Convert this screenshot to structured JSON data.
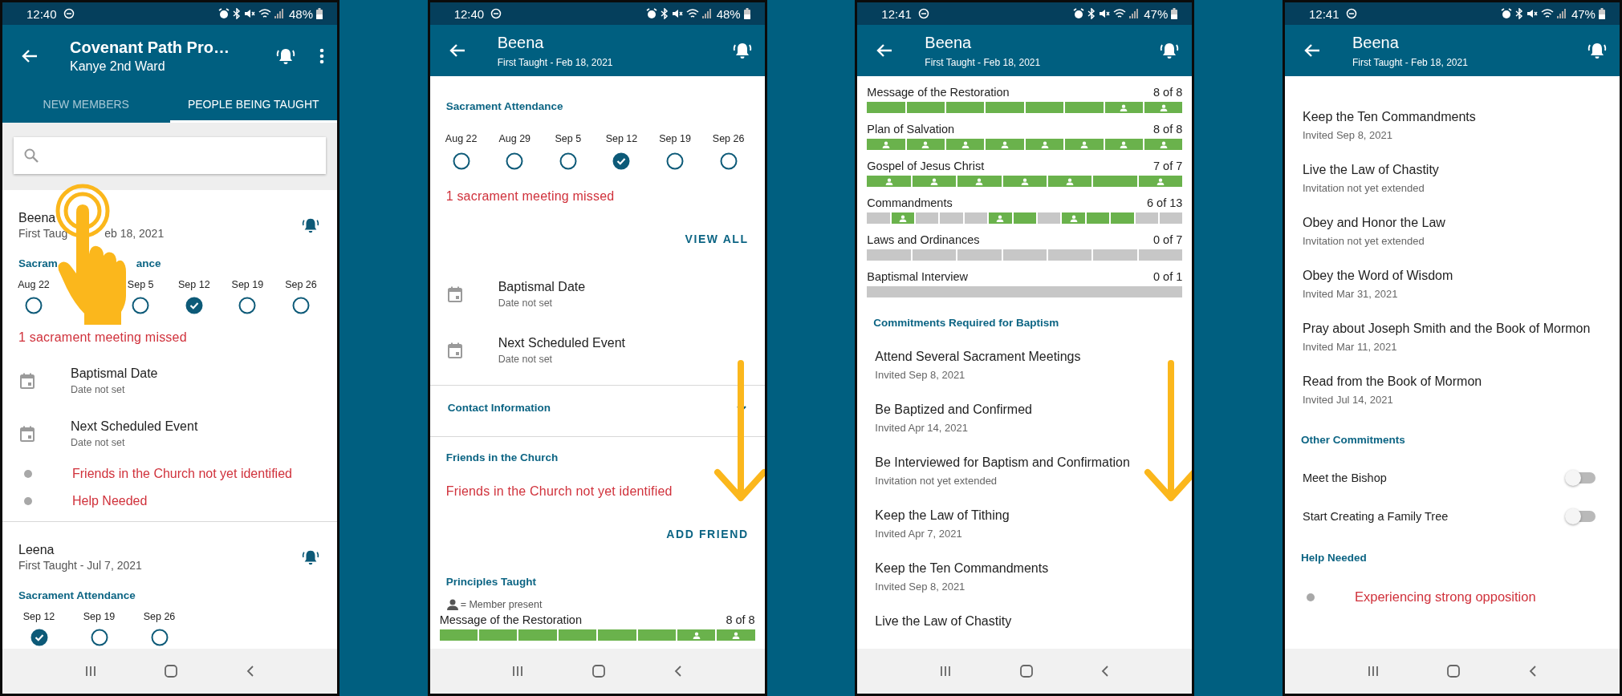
{
  "phones": [
    {
      "status": {
        "time": "12:40",
        "battery": "48%"
      },
      "header": {
        "title": "Covenant Path Pro…",
        "subtitle": "Kanye 2nd Ward",
        "actions": [
          {
            "kind": "bell"
          },
          {
            "kind": "menu"
          }
        ]
      },
      "tabs": [
        {
          "label": "NEW MEMBERS",
          "selected": false
        },
        {
          "label": "PEOPLE BEING TAUGHT",
          "selected": true
        }
      ],
      "search": {
        "kind": "field"
      },
      "overlay": {
        "kind": "tap"
      },
      "blocks": [
        {
          "kind": "person",
          "name": "Beena",
          "subtitle_parts": [
            "First Taug",
            "eb 18, 2021"
          ]
        },
        {
          "kind": "heading",
          "text_parts": [
            "Sacram",
            "ance"
          ]
        },
        {
          "kind": "attendance",
          "dates": [
            {
              "label": "Aug 22",
              "checked": false
            },
            {
              "label": "Sep 5",
              "checked": false
            },
            {
              "label": "Sep 12",
              "checked": true
            },
            {
              "label": "Sep 19",
              "checked": false
            },
            {
              "label": "Sep 26",
              "checked": false
            }
          ]
        },
        {
          "kind": "warning",
          "text": "1 sacrament meeting missed"
        },
        {
          "kind": "event",
          "title": "Baptismal Date",
          "detail": "Date not set"
        },
        {
          "kind": "event",
          "title": "Next Scheduled Event",
          "detail": "Date not set"
        },
        {
          "kind": "dot_alert",
          "text": "Friends in the Church not yet identified"
        },
        {
          "kind": "dot_alert",
          "text": "Help Needed"
        },
        {
          "kind": "divider"
        },
        {
          "kind": "person",
          "name": "Leena",
          "subtitle_parts": [
            "First Taught - Jul 7, 2021"
          ]
        },
        {
          "kind": "heading",
          "text_parts": [
            "Sacrament Attendance"
          ]
        },
        {
          "kind": "attendance",
          "dates": [
            {
              "label": "Sep 12",
              "checked": true
            },
            {
              "label": "Sep 19",
              "checked": false
            },
            {
              "label": "Sep 26",
              "checked": false
            }
          ]
        }
      ]
    },
    {
      "status": {
        "time": "12:40",
        "battery": "48%"
      },
      "header": {
        "title": "Beena",
        "subtitle": "First Taught - Feb 18, 2021",
        "actions": [
          {
            "kind": "bell"
          }
        ]
      },
      "overlay": {
        "kind": "swipe"
      },
      "blocks": [
        {
          "kind": "heading",
          "text_parts": [
            "Sacrament Attendance"
          ]
        },
        {
          "kind": "attendance",
          "dates": [
            {
              "label": "Aug 22",
              "checked": false
            },
            {
              "label": "Aug 29",
              "checked": false
            },
            {
              "label": "Sep 5",
              "checked": false
            },
            {
              "label": "Sep 12",
              "checked": true
            },
            {
              "label": "Sep 19",
              "checked": false
            },
            {
              "label": "Sep 26",
              "checked": false
            }
          ]
        },
        {
          "kind": "warning",
          "text": "1 sacrament meeting missed"
        },
        {
          "kind": "link",
          "text": "VIEW ALL"
        },
        {
          "kind": "event",
          "title": "Baptismal Date",
          "detail": "Date not set"
        },
        {
          "kind": "event",
          "title": "Next Scheduled Event",
          "detail": "Date not set"
        },
        {
          "kind": "divider"
        },
        {
          "kind": "collapsible",
          "text": "Contact Information",
          "expanded": false
        },
        {
          "kind": "divider"
        },
        {
          "kind": "heading",
          "text_parts": [
            "Friends in the Church"
          ]
        },
        {
          "kind": "warning",
          "text": "Friends in the Church not yet identified"
        },
        {
          "kind": "link",
          "text": "ADD FRIEND"
        },
        {
          "kind": "heading",
          "text_parts": [
            "Principles Taught"
          ]
        },
        {
          "kind": "legend",
          "text": "= Member present"
        },
        {
          "kind": "progress",
          "name": "Message of the Restoration",
          "count": "8 of 8",
          "segments": [
            {
              "kind": "done"
            },
            {
              "kind": "done"
            },
            {
              "kind": "done"
            },
            {
              "kind": "done"
            },
            {
              "kind": "done"
            },
            {
              "kind": "done"
            },
            {
              "kind": "member"
            },
            {
              "kind": "member"
            }
          ]
        }
      ]
    },
    {
      "status": {
        "time": "12:41",
        "battery": "47%"
      },
      "header": {
        "title": "Beena",
        "subtitle": "First Taught - Feb 18, 2021",
        "actions": [
          {
            "kind": "bell"
          }
        ]
      },
      "overlay": {
        "kind": "swipe"
      },
      "blocks": [
        {
          "kind": "progress",
          "name": "Message of the Restoration",
          "count": "8 of 8",
          "segments": [
            {
              "kind": "done"
            },
            {
              "kind": "done"
            },
            {
              "kind": "done"
            },
            {
              "kind": "done"
            },
            {
              "kind": "done"
            },
            {
              "kind": "done"
            },
            {
              "kind": "member"
            },
            {
              "kind": "member"
            }
          ]
        },
        {
          "kind": "progress",
          "name": "Plan of Salvation",
          "count": "8 of 8",
          "segments": [
            {
              "kind": "member"
            },
            {
              "kind": "member"
            },
            {
              "kind": "member"
            },
            {
              "kind": "member"
            },
            {
              "kind": "member"
            },
            {
              "kind": "member"
            },
            {
              "kind": "member"
            },
            {
              "kind": "member"
            }
          ]
        },
        {
          "kind": "progress",
          "name": "Gospel of Jesus Christ",
          "count": "7 of 7",
          "segments": [
            {
              "kind": "member"
            },
            {
              "kind": "member"
            },
            {
              "kind": "member"
            },
            {
              "kind": "member"
            },
            {
              "kind": "member"
            },
            {
              "kind": "done"
            },
            {
              "kind": "member"
            }
          ]
        },
        {
          "kind": "progress",
          "name": "Commandments",
          "count": "6 of 13",
          "segments": [
            {
              "kind": "none"
            },
            {
              "kind": "member"
            },
            {
              "kind": "none"
            },
            {
              "kind": "none"
            },
            {
              "kind": "none"
            },
            {
              "kind": "member"
            },
            {
              "kind": "done"
            },
            {
              "kind": "none"
            },
            {
              "kind": "member"
            },
            {
              "kind": "done"
            },
            {
              "kind": "done"
            },
            {
              "kind": "none"
            },
            {
              "kind": "none"
            }
          ]
        },
        {
          "kind": "progress",
          "name": "Laws and Ordinances",
          "count": "0 of 7",
          "segments": [
            {
              "kind": "none"
            },
            {
              "kind": "none"
            },
            {
              "kind": "none"
            },
            {
              "kind": "none"
            },
            {
              "kind": "none"
            },
            {
              "kind": "none"
            },
            {
              "kind": "none"
            }
          ]
        },
        {
          "kind": "progress",
          "name": "Baptismal Interview",
          "count": "0 of 1",
          "segments": [
            {
              "kind": "none"
            }
          ]
        },
        {
          "kind": "heading",
          "text_parts": [
            "Commitments Required for Baptism"
          ]
        },
        {
          "kind": "commitment",
          "title": "Attend Several Sacrament Meetings",
          "detail": "Invited Sep 8, 2021"
        },
        {
          "kind": "commitment",
          "title": "Be Baptized and Confirmed",
          "detail": "Invited Apr 14, 2021"
        },
        {
          "kind": "commitment",
          "title": "Be Interviewed for Baptism and Confirmation",
          "detail": "Invitation not yet extended"
        },
        {
          "kind": "commitment",
          "title": "Keep the Law of Tithing",
          "detail": "Invited Apr 7, 2021"
        },
        {
          "kind": "commitment",
          "title": "Keep the Ten Commandments",
          "detail": "Invited Sep 8, 2021"
        },
        {
          "kind": "commitment",
          "title": "Live the Law of Chastity"
        }
      ]
    },
    {
      "status": {
        "time": "12:41",
        "battery": "47%"
      },
      "header": {
        "title": "Beena",
        "subtitle": "First Taught - Feb 18, 2021",
        "actions": [
          {
            "kind": "bell"
          }
        ]
      },
      "blocks": [
        {
          "kind": "commitment",
          "title": "Keep the Ten Commandments",
          "detail": "Invited Sep 8, 2021"
        },
        {
          "kind": "commitment",
          "title": "Live the Law of Chastity",
          "detail": "Invitation not yet extended"
        },
        {
          "kind": "commitment",
          "title": "Obey and Honor the Law",
          "detail": "Invitation not yet extended"
        },
        {
          "kind": "commitment",
          "title": "Obey the Word of Wisdom",
          "detail": "Invited Mar 31, 2021"
        },
        {
          "kind": "commitment",
          "title": "Pray about Joseph Smith and the Book of Mormon",
          "detail": "Invited Mar 11, 2021"
        },
        {
          "kind": "commitment",
          "title": "Read from the Book of Mormon",
          "detail": "Invited Jul 14, 2021"
        },
        {
          "kind": "heading",
          "text_parts": [
            "Other Commitments"
          ]
        },
        {
          "kind": "toggle",
          "text": "Meet the Bishop",
          "on": false
        },
        {
          "kind": "toggle",
          "text": "Start Creating a Family Tree",
          "on": false
        },
        {
          "kind": "heading",
          "text_parts": [
            "Help Needed"
          ]
        },
        {
          "kind": "dot_alert",
          "text": "Experiencing strong opposition"
        }
      ]
    }
  ]
}
